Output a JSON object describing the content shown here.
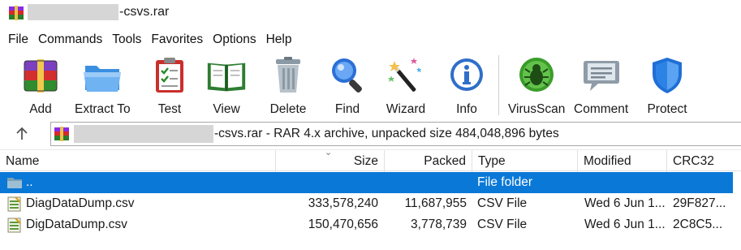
{
  "window": {
    "title_suffix": "-csvs.rar"
  },
  "menu": [
    "File",
    "Commands",
    "Tools",
    "Favorites",
    "Options",
    "Help"
  ],
  "toolbar": {
    "add": "Add",
    "extract": "Extract To",
    "test": "Test",
    "view": "View",
    "delete": "Delete",
    "find": "Find",
    "wizard": "Wizard",
    "info": "Info",
    "virusscan": "VirusScan",
    "comment": "Comment",
    "protect": "Protect"
  },
  "address": {
    "text": "-csvs.rar - RAR 4.x archive, unpacked size 484,048,896 bytes"
  },
  "columns": {
    "name": "Name",
    "size": "Size",
    "packed": "Packed",
    "type": "Type",
    "modified": "Modified",
    "crc": "CRC32"
  },
  "rows": [
    {
      "name": "..",
      "size": "",
      "packed": "",
      "type": "File folder",
      "modified": "",
      "crc": "",
      "icon": "folder-icon"
    },
    {
      "name": "DiagDataDump.csv",
      "size": "333,578,240",
      "packed": "11,687,955",
      "type": "CSV File",
      "modified": "Wed 6 Jun 1...",
      "crc": "29F827...",
      "icon": "csv-file-icon"
    },
    {
      "name": "DigDataDump.csv",
      "size": "150,470,656",
      "packed": "3,778,739",
      "type": "CSV File",
      "modified": "Wed 6 Jun 1...",
      "crc": "2C8C5...",
      "icon": "csv-file-icon"
    }
  ],
  "colors": {
    "selection": "#0a78d7",
    "selection_text": "#ffffff"
  }
}
